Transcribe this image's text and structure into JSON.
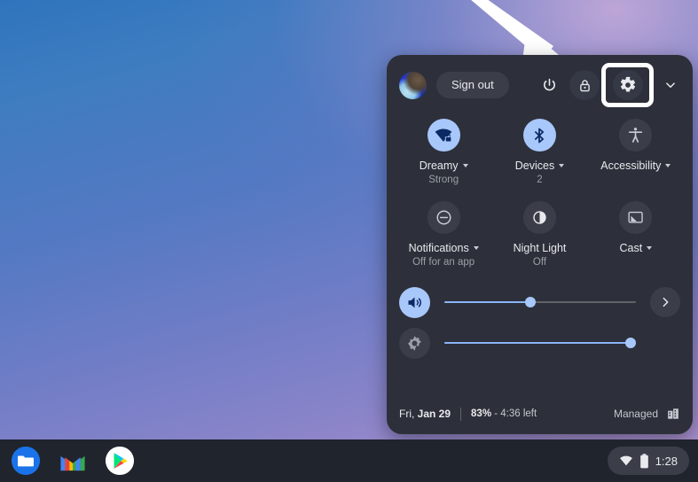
{
  "desktop": {
    "wallpaper_gradient_start": "#2f74bd",
    "wallpaper_gradient_end": "#b394cd",
    "annotation": {
      "type": "arrow",
      "name": "pointer-arrow",
      "color": "#ffffff",
      "points_to": "settings-button"
    }
  },
  "quick_settings": {
    "header": {
      "avatar_name": "user-avatar",
      "sign_out_label": "Sign out",
      "power_icon": "power-icon",
      "lock_icon": "lock-icon",
      "settings_icon": "gear-icon",
      "collapse_icon": "chevron-down-icon",
      "highlight_color": "#ffffff",
      "highlighted_button": "settings-button"
    },
    "tiles": [
      {
        "id": "network",
        "icon": "wifi-locked-icon",
        "label": "Dreamy",
        "sublabel": "Strong",
        "state": "on",
        "has_caret": true
      },
      {
        "id": "bluetooth",
        "icon": "bluetooth-icon",
        "label": "Devices",
        "sublabel": "2",
        "state": "on",
        "has_caret": true
      },
      {
        "id": "accessibility",
        "icon": "accessibility-icon",
        "label": "Accessibility",
        "sublabel": "",
        "state": "off",
        "has_caret": true
      },
      {
        "id": "notifications",
        "icon": "do-not-disturb-icon",
        "label": "Notifications",
        "sublabel": "Off for an app",
        "state": "off",
        "has_caret": true
      },
      {
        "id": "night_light",
        "icon": "night-light-icon",
        "label": "Night Light",
        "sublabel": "Off",
        "state": "off",
        "has_caret": false
      },
      {
        "id": "cast",
        "icon": "cast-icon",
        "label": "Cast",
        "sublabel": "",
        "state": "off",
        "has_caret": true
      }
    ],
    "sliders": [
      {
        "id": "volume",
        "icon": "volume-up-icon",
        "value": 45,
        "state": "on",
        "trailing_icon": "chevron-right-icon"
      },
      {
        "id": "brightness",
        "icon": "brightness-icon",
        "value": 97,
        "state": "off",
        "trailing_icon": ""
      }
    ],
    "footer": {
      "date_prefix": "Fri, ",
      "date_value": "Jan 29",
      "battery_percent": "83%",
      "battery_remaining": " - 4:36 left",
      "managed_label": "Managed",
      "managed_icon": "enterprise-building-icon"
    },
    "accent_color": "#a8c7fa",
    "panel_bg": "#2d303a"
  },
  "shelf": {
    "apps": [
      {
        "id": "files",
        "name": "files-app-icon"
      },
      {
        "id": "gmail",
        "name": "gmail-app-icon"
      },
      {
        "id": "play_store",
        "name": "play-store-app-icon"
      }
    ],
    "tray": {
      "wifi_icon": "wifi-icon",
      "battery_icon": "battery-icon",
      "time": "1:28"
    },
    "background": "#20242c"
  }
}
